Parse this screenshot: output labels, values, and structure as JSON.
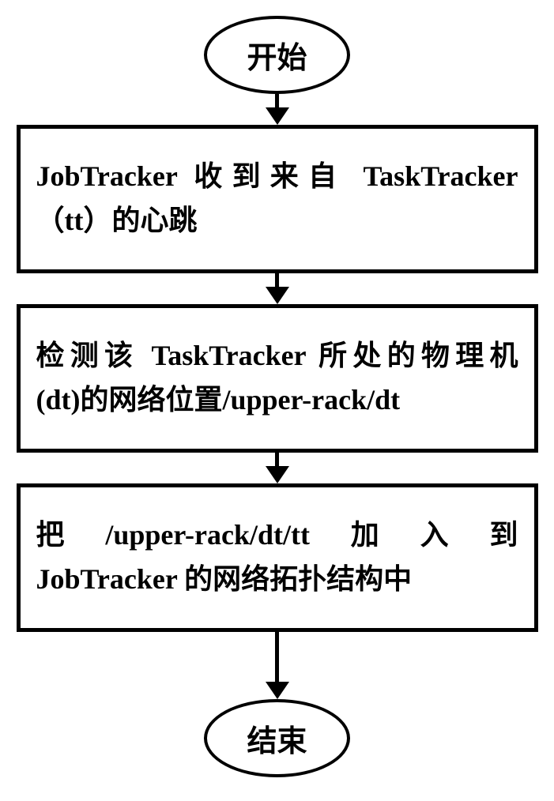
{
  "flowchart": {
    "start": "开始",
    "step1_line1": "JobTracker 收到来自 TaskTracker",
    "step1_line2": "（tt）的心跳",
    "step2_line1": "检测该 TaskTracker 所处的物理机",
    "step2_line2": "(dt)的网络位置/upper-rack/dt",
    "step3_w1": "把",
    "step3_w2": "/upper-rack/dt/tt",
    "step3_w3": "加",
    "step3_w4": "入",
    "step3_w5": "到",
    "step3_line2": "JobTracker 的网络拓扑结构中",
    "end": "结束"
  }
}
